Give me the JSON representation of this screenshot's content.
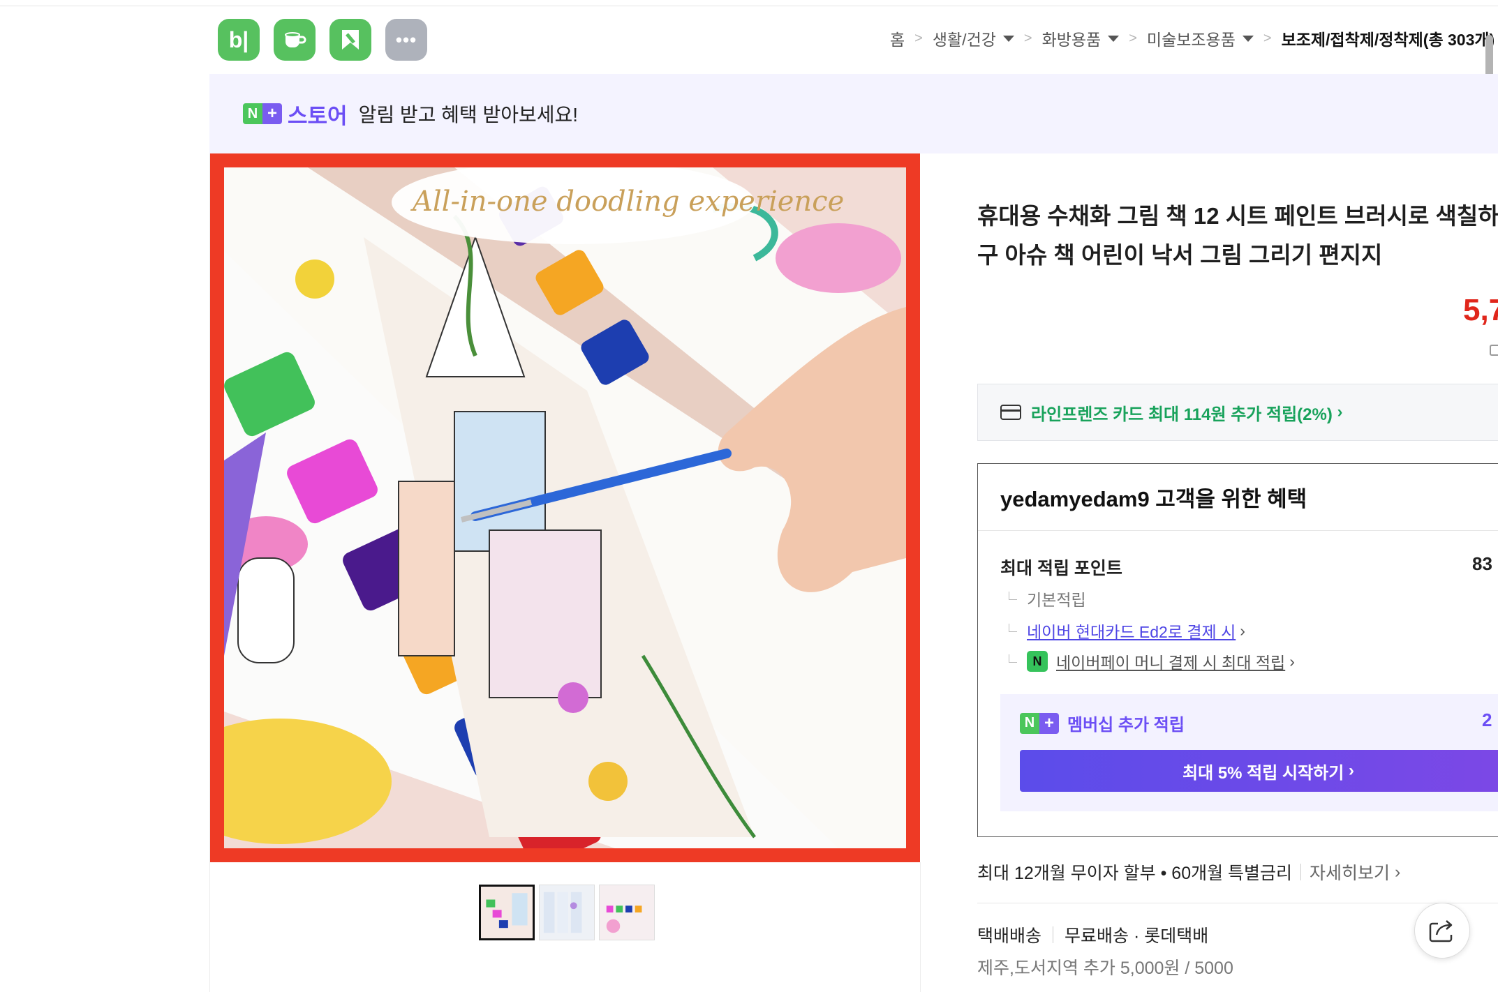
{
  "app_icons": [
    {
      "name": "blog-icon",
      "label": "b|"
    },
    {
      "name": "cafe-icon",
      "label": ""
    },
    {
      "name": "bookmark-icon",
      "label": ""
    },
    {
      "name": "more-icon",
      "label": "•••"
    }
  ],
  "breadcrumb": {
    "items": [
      "홈",
      "생활/건강",
      "화방용품",
      "미술보조용품"
    ],
    "current": "보조제/접착제/정착제(총 303개)"
  },
  "banner": {
    "badge_n": "N",
    "badge_plus": "+",
    "store": "스토어",
    "message": "알림 받고 혜택 받아보세요!"
  },
  "product": {
    "image_caption": "All-in-one doodling experience",
    "title_line1": "휴대용 수채화 그림 책 12 시트 페인트 브러시로 색칠하",
    "title_line2": "구 아슈 책 어린이 낙서 그림 그리기 편지지",
    "price": "5,7"
  },
  "card_offer": "라인프렌즈 카드 최대 114원 추가 적립(2%)",
  "benefit": {
    "header": "yedamyedam9 고객을 위한 혜택",
    "max_points_label": "최대 적립 포인트",
    "max_points_value": "83",
    "basic": "기본적립",
    "hyundai_card": "네이버 현대카드 Ed2로 결제 시",
    "npay_money": "네이버페이 머니 결제 시 최대 적립",
    "npay_badge": "N",
    "member_label": "멤버십 추가 적립",
    "member_value": "2",
    "member_button": "최대 5% 적립 시작하기"
  },
  "installment": {
    "text": "최대 12개월 무이자 할부 • 60개월 특별금리",
    "more": "자세히보기"
  },
  "shipping": {
    "method": "택배배송",
    "fee": "무료배송 · 롯데택배",
    "extra": "제주,도서지역 추가 5,000원 / 5000"
  },
  "colors": {
    "naver_green": "#4bc65b",
    "store_purple": "#6b4ef5",
    "price_red": "#e0261b",
    "image_frame_red": "#ee3a25"
  }
}
